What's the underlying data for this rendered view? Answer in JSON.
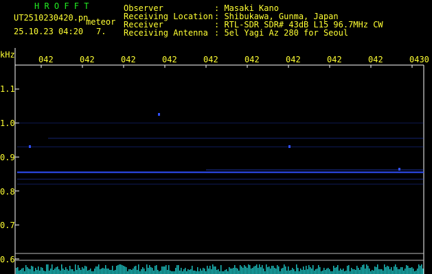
{
  "header": {
    "program": "H R O F F T",
    "filename": "UT2510230420.pn",
    "datetime": "25.10.23 04:20",
    "detection_label": "meteor",
    "detection_count": "7.",
    "info_labels": [
      "Observer",
      "Receiving Location",
      "Receiver",
      "Receiving Antenna"
    ],
    "info_values": [
      ": Masaki Kano",
      ": Shibukawa, Gunma, Japan",
      ": RTL-SDR SDR# 43dB L15 96.7MHz CW",
      ": 5el Yagi Az 280 for Seoul"
    ]
  },
  "colors": {
    "text_yellow": "#ffff33",
    "text_green": "#22ee22",
    "grid_white": "#ffffff",
    "echo_blue": "#3050ff",
    "noise_cyan": "#22dddd"
  },
  "chart_data": {
    "type": "heatmap",
    "y_unit_label": "kHz",
    "y_tick_labels": [
      "1.1",
      "1.0",
      "0.9",
      "0.8",
      "0.7",
      "0.6"
    ],
    "y_ticks": [
      1.1,
      1.0,
      0.9,
      0.8,
      0.7,
      0.6
    ],
    "ylim": [
      0.58,
      1.2
    ],
    "x_tick_labels": [
      "042",
      "042",
      "042",
      "042",
      "042",
      "042",
      "042",
      "042",
      "042",
      "0430"
    ],
    "signal_traces_khz": [
      0.855,
      0.862,
      0.835,
      0.82,
      0.93,
      0.955,
      1.0
    ],
    "grid": true
  }
}
